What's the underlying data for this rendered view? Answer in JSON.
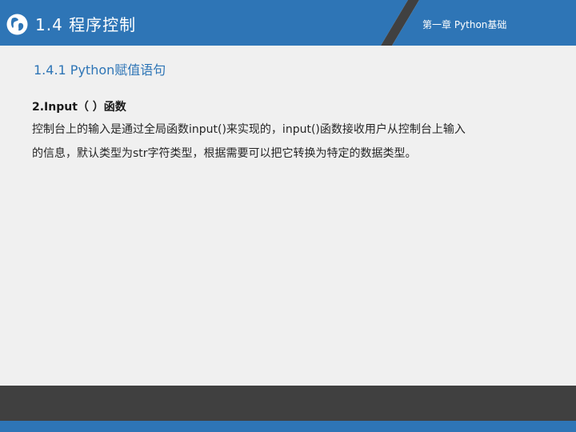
{
  "header": {
    "section_title": "1.4 程序控制",
    "chapter_label": "第一章 Python基础",
    "colors": {
      "band_left": "#2e75b6",
      "band_right": "#2e75b6",
      "divider": "#404040"
    }
  },
  "content": {
    "subsection_title": "1.4.1 Python赋值语句",
    "function_heading": "2.Input（ ）函数",
    "paragraph_lines": [
      "控制台上的输入是通过全局函数input()来实现的，input()函数接收用户从控制台上输入",
      "的信息，默认类型为str字符类型，根据需要可以把它转换为特定的数据类型。"
    ]
  },
  "footer": {
    "colors": {
      "dark": "#404040",
      "accent": "#2e75b6"
    }
  }
}
